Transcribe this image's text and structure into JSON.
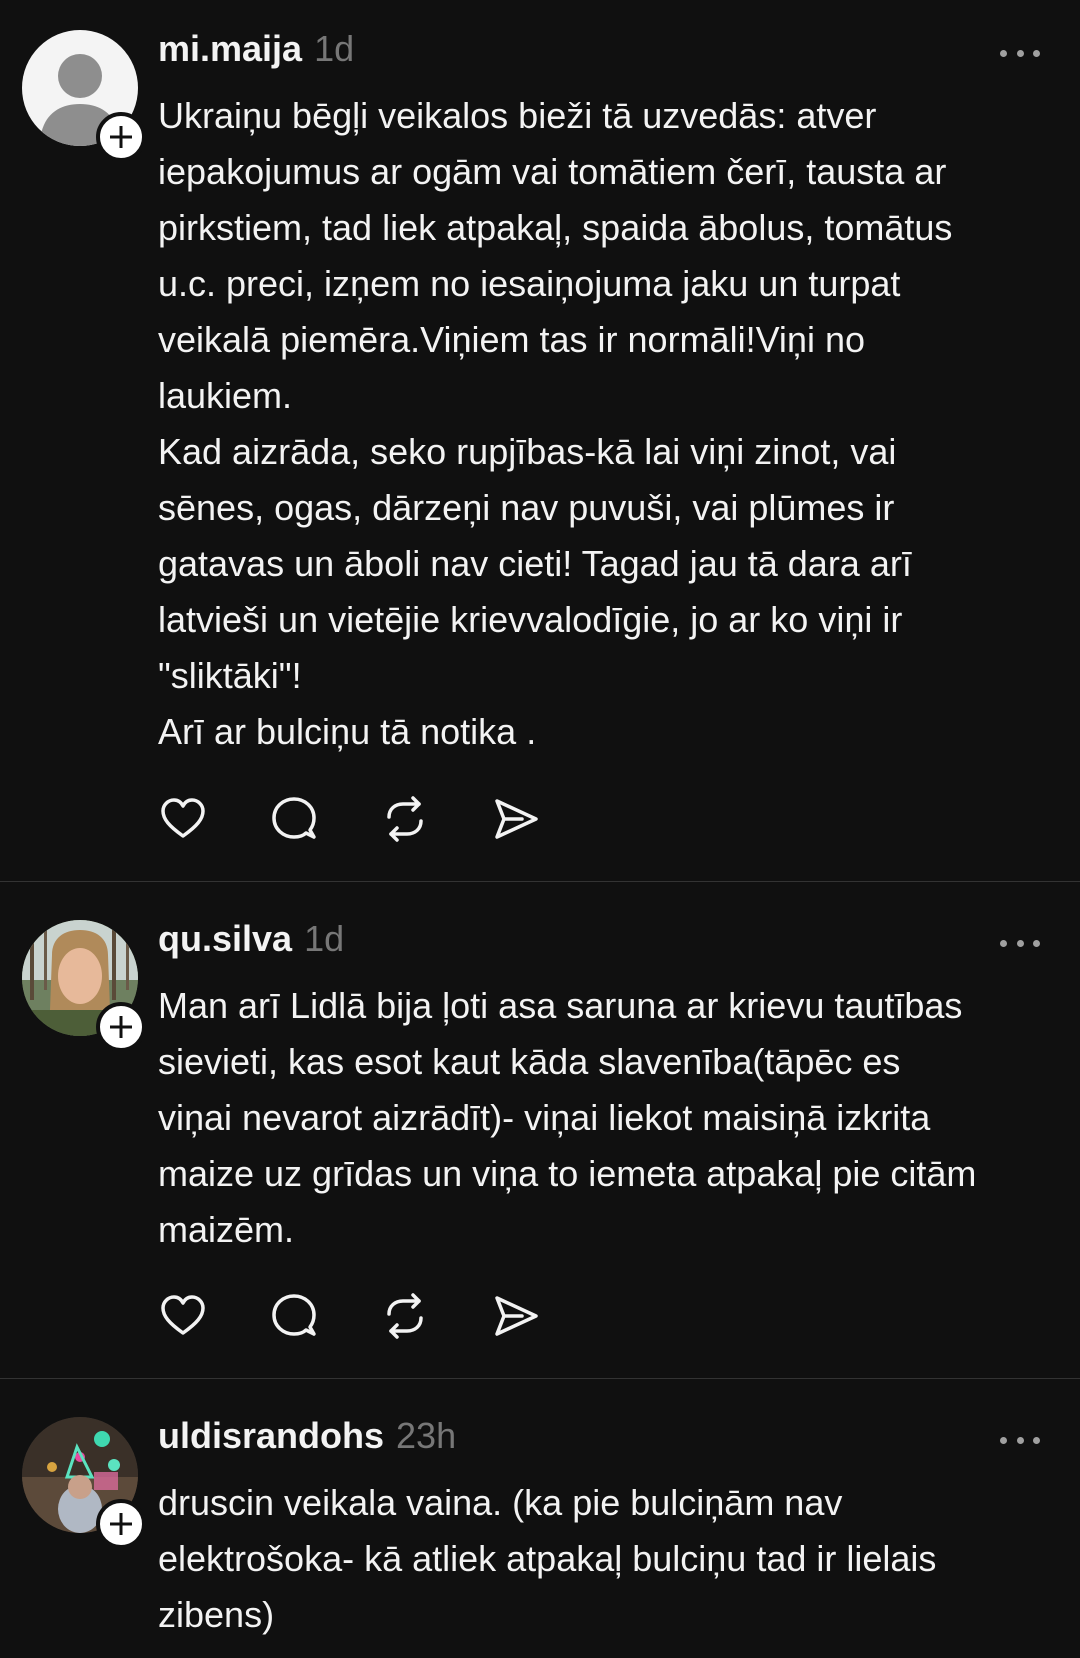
{
  "posts": [
    {
      "username": "mi.maija",
      "time": "1d",
      "avatar": "default-person-icon",
      "lines": [
        "Ukraiņu bēgļi veikalos bieži tā uzvedās: atver",
        "iepakojumus ar ogām vai tomātiem čerī, tausta ar",
        "pirkstiem, tad liek atpakaļ, spaida ābolus, tomātus",
        "u.c. preci, izņem no iesaiņojuma jaku un turpat",
        "veikalā piemēra.Viņiem tas ir normāli!Viņi no",
        "laukiem.",
        "Kad aizrāda, seko rupjības-kā lai viņi zinot, vai",
        "sēnes, ogas, dārzeņi nav puvuši, vai plūmes ir",
        "gatavas un āboli nav cieti! Tagad jau tā dara arī",
        "latvieši un vietējie krievvalodīgie, jo ar ko viņi ir",
        "\"sliktāki\"!",
        "Arī ar bulciņu tā notika ."
      ]
    },
    {
      "username": "qu.silva",
      "time": "1d",
      "avatar": "photo-avatar-woman-forest",
      "lines": [
        "Man arī Lidlā bija ļoti asa saruna ar krievu tautības",
        "sievieti, kas esot kaut kāda slavenība(tāpēc es",
        "viņai nevarot aizrādīt)- viņai liekot maisiņā izkrita",
        "maize uz grīdas un viņa to iemeta atpakaļ pie citām",
        "maizēm."
      ]
    },
    {
      "username": "uldisrandohs",
      "time": "23h",
      "avatar": "photo-avatar-neon-lights",
      "lines": [
        "druscin veikala vaina. (ka pie bulciņām nav",
        "elektrošoka- kā atliek atpakaļ bulciņu tad ir lielais",
        "zibens)"
      ]
    }
  ],
  "actions": {
    "like": "heart-icon",
    "reply": "comment-icon",
    "repost": "repost-icon",
    "share": "send-icon"
  },
  "colors": {
    "background": "#101010",
    "text": "#f3f3f3",
    "muted": "#777777",
    "divider": "#333333"
  }
}
